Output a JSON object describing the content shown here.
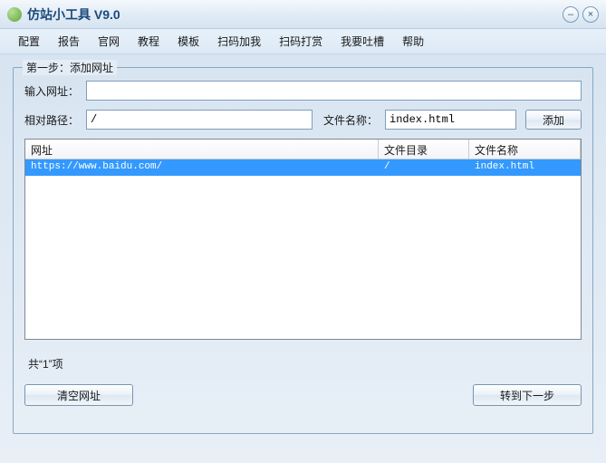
{
  "title": "仿站小工具 V9.0",
  "menu": [
    "配置",
    "报告",
    "官网",
    "教程",
    "模板",
    "扫码加我",
    "扫码打赏",
    "我要吐槽",
    "帮助"
  ],
  "step1": {
    "legend": "第一步：添加网址",
    "label_url": "输入网址：",
    "url_value": "",
    "label_path": "相对路径：",
    "path_value": "/",
    "label_fname": "文件名称：",
    "fname_value": "index.html",
    "add_label": "添加",
    "columns": {
      "url": "网址",
      "dir": "文件目录",
      "fname": "文件名称"
    },
    "rows": [
      {
        "url": "https://www.baidu.com/",
        "dir": "/",
        "fname": "index.html"
      }
    ],
    "count_text": "共“1”项",
    "clear_label": "清空网址",
    "next_label": "转到下一步"
  }
}
